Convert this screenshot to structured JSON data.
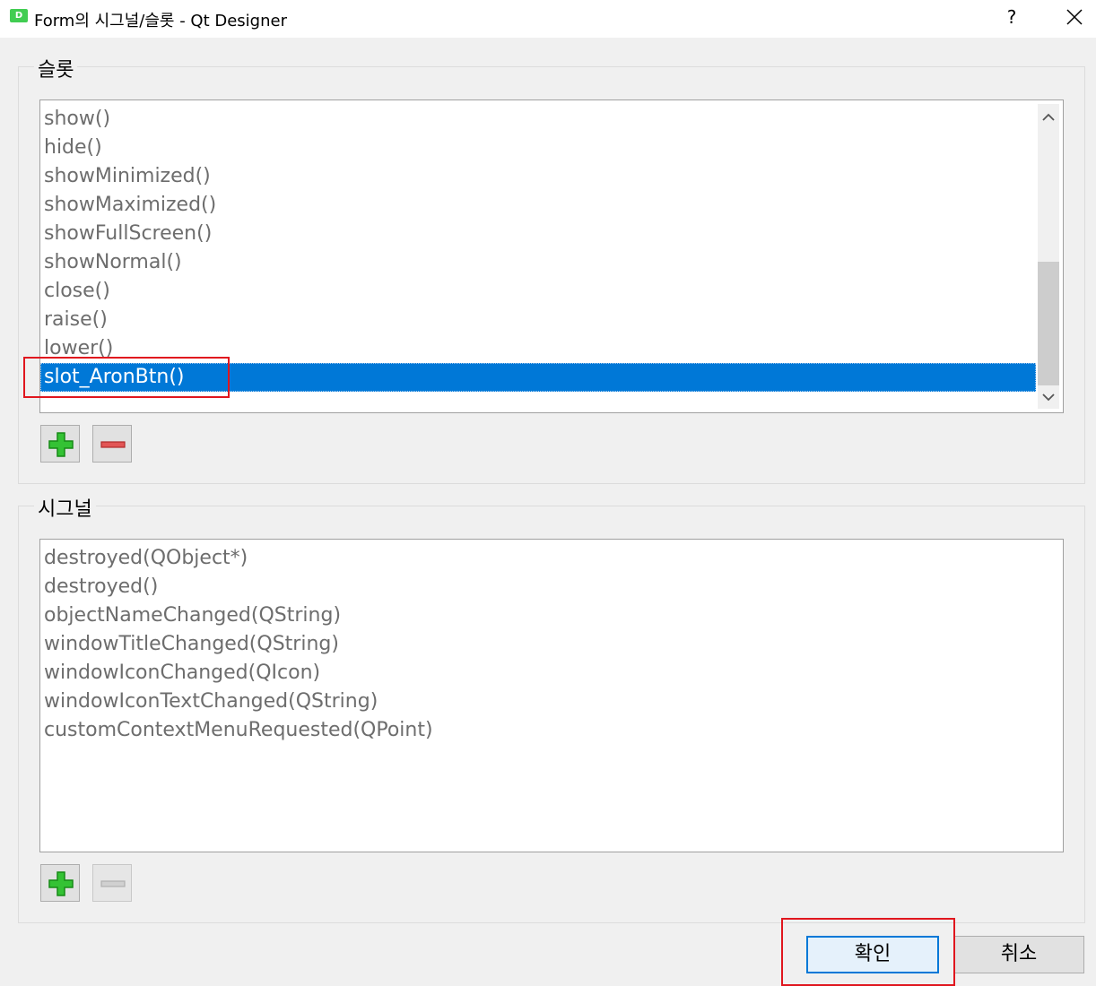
{
  "window": {
    "app_icon_letter": "D",
    "title": "Form의 시그널/슬롯 - Qt Designer",
    "help_label": "?"
  },
  "slots": {
    "group_title": "슬롯",
    "items": [
      "show()",
      "hide()",
      "showMinimized()",
      "showMaximized()",
      "showFullScreen()",
      "showNormal()",
      "close()",
      "raise()",
      "lower()",
      "slot_AronBtn()"
    ],
    "selected_index": 9
  },
  "signals": {
    "group_title": "시그널",
    "items": [
      "destroyed(QObject*)",
      "destroyed()",
      "objectNameChanged(QString)",
      "windowTitleChanged(QString)",
      "windowIconChanged(QIcon)",
      "windowIconTextChanged(QString)",
      "customContextMenuRequested(QPoint)"
    ]
  },
  "buttons": {
    "ok_label": "확인",
    "cancel_label": "취소"
  },
  "icons": {
    "add": "plus-icon",
    "remove": "minus-icon",
    "close": "close-icon",
    "scroll_up": "chevron-up-icon",
    "scroll_down": "chevron-down-icon"
  },
  "colors": {
    "selection": "#0078d7",
    "annotation": "#e0161e",
    "add_green": "#2fb52f",
    "remove_red": "#e25555"
  }
}
